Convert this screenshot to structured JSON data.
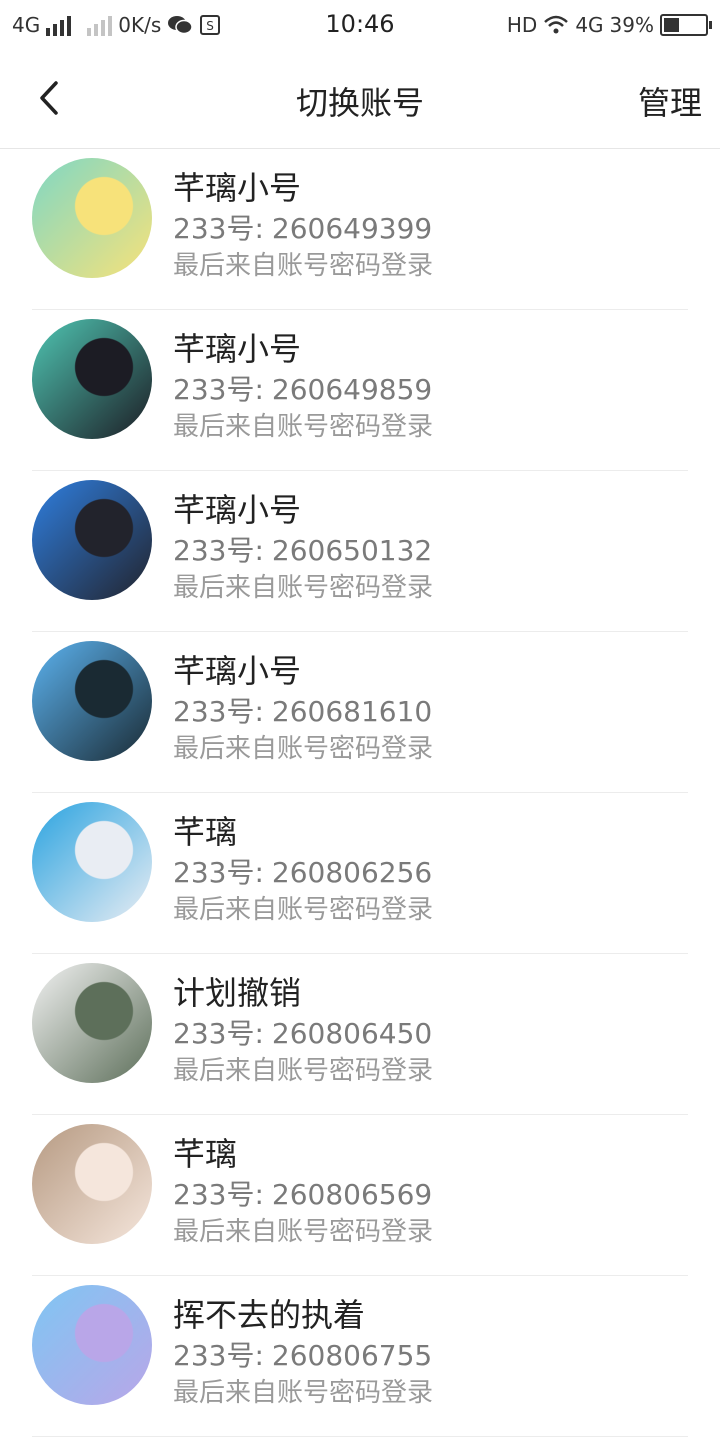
{
  "status_bar": {
    "network_left": "4G",
    "speed": "0K/s",
    "time": "10:46",
    "hd": "HD",
    "network_right": "4G",
    "battery": "39%",
    "battery_level": 0.39
  },
  "header": {
    "title": "切换账号",
    "manage_label": "管理",
    "back_icon": "chevron-left-icon"
  },
  "accounts": [
    {
      "name": "芊璃小号",
      "id_label": "233号:",
      "id": "260649399",
      "login_info": "最后来自账号密码登录",
      "avatar_colors": [
        "#7fd7c4",
        "#f7e27a"
      ]
    },
    {
      "name": "芊璃小号",
      "id_label": "233号:",
      "id": "260649859",
      "login_info": "最后来自账号密码登录",
      "avatar_colors": [
        "#4fc6b3",
        "#1c1c24"
      ]
    },
    {
      "name": "芊璃小号",
      "id_label": "233号:",
      "id": "260650132",
      "login_info": "最后来自账号密码登录",
      "avatar_colors": [
        "#2f7fe0",
        "#22232c"
      ]
    },
    {
      "name": "芊璃小号",
      "id_label": "233号:",
      "id": "260681610",
      "login_info": "最后来自账号密码登录",
      "avatar_colors": [
        "#5cb3f0",
        "#1a2a33"
      ]
    },
    {
      "name": "芊璃",
      "id_label": "233号:",
      "id": "260806256",
      "login_info": "最后来自账号密码登录",
      "avatar_colors": [
        "#2aa3e0",
        "#e9edf3"
      ]
    },
    {
      "name": "计划撤销",
      "id_label": "233号:",
      "id": "260806450",
      "login_info": "最后来自账号密码登录",
      "avatar_colors": [
        "#f2f2f2",
        "#5d6f5a"
      ]
    },
    {
      "name": "芊璃",
      "id_label": "233号:",
      "id": "260806569",
      "login_info": "最后来自账号密码登录",
      "avatar_colors": [
        "#b69a82",
        "#f5e6dc"
      ]
    },
    {
      "name": "挥不去的执着",
      "id_label": "233号:",
      "id": "260806755",
      "login_info": "最后来自账号密码登录",
      "avatar_colors": [
        "#7fc6f3",
        "#b9a6e8"
      ]
    }
  ]
}
